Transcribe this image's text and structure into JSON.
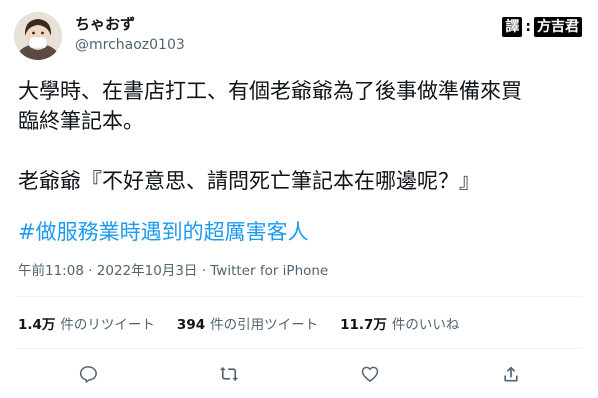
{
  "author": {
    "display_name": "ちゃおず",
    "handle": "@mrchaoz0103"
  },
  "watermark": {
    "left": "譯",
    "colon": ":",
    "right": "方吉君"
  },
  "tweet": {
    "lines": [
      "大學時、在書店打工、有個老爺爺為了後事做準備來買",
      "臨終筆記本。",
      "",
      "老爺爺『不好意思、請問死亡筆記本在哪邊呢？』"
    ],
    "hashtag": "#做服務業時遇到的超厲害客人"
  },
  "meta": {
    "time": "午前11:08",
    "sep1": " · ",
    "date": "2022年10月3日",
    "sep2": " · ",
    "source": "Twitter for iPhone"
  },
  "stats": {
    "retweets": {
      "count": "1.4万",
      "label": "件のリツイート"
    },
    "quotes": {
      "count": "394",
      "label": "件の引用ツイート"
    },
    "likes": {
      "count": "11.7万",
      "label": "件のいいね"
    }
  },
  "actions": {
    "reply": "reply-icon",
    "retweet": "retweet-icon",
    "like": "heart-icon",
    "share": "share-icon"
  },
  "colors": {
    "text": "#0f1419",
    "secondary": "#536471",
    "link": "#1d9bf0",
    "divider": "#eff3f4"
  }
}
